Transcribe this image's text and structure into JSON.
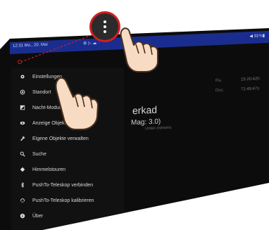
{
  "statusbar": {
    "time": "12:31  Mo., 20. Mai",
    "icons": "⚙ ▷ ☁ ·",
    "battery": "◀ 91%▮"
  },
  "main": {
    "object_name": "erkad",
    "magnitude": "Mag: 3.0)",
    "sub_label": "Unter-minions",
    "ra_label": "Ra.",
    "ra_value": "15:20:42h",
    "dec_label": "Dec.",
    "dec_value": "71:49:47s"
  },
  "drawer": {
    "items": [
      {
        "label": "Einstellungen",
        "icon": "gear-icon"
      },
      {
        "label": "Standort",
        "icon": "location-icon"
      },
      {
        "label": "Nacht-Modus",
        "icon": "night-mode-icon"
      },
      {
        "label": "Anzeige Objektarten",
        "icon": "eye-icon"
      },
      {
        "label": "Eigene Objekte verwalten",
        "icon": "wrench-icon"
      },
      {
        "label": "Suche",
        "icon": "search-icon"
      },
      {
        "label": "Himmelstouren",
        "icon": "tour-icon"
      },
      {
        "label": "PushTo-Teleskop verbinden",
        "icon": "bluetooth-icon"
      },
      {
        "label": "PushTo-Teleskop kalibrieren",
        "icon": "calibrate-icon"
      },
      {
        "label": "Über",
        "icon": "info-icon"
      }
    ]
  },
  "colors": {
    "statusbar": "#1a2d8f",
    "highlight_ring": "#d02020",
    "drawer_bg": "#111111",
    "screen_bg": "#0c0c0c"
  }
}
